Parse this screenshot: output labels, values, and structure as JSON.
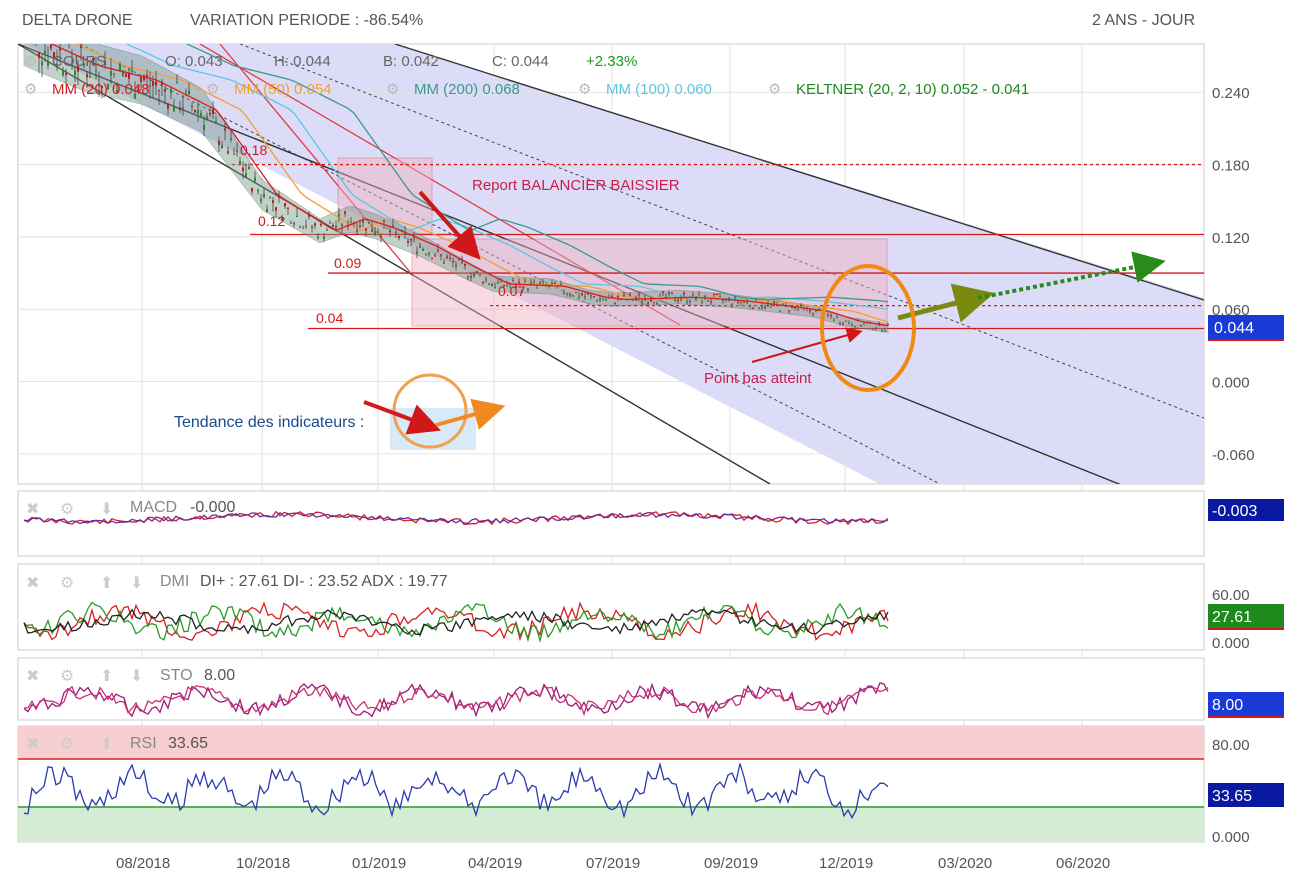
{
  "header": {
    "ticker": "DELTA DRONE",
    "variation": "VARIATION PERIODE : -86.54%",
    "period": "2 ANS - JOUR"
  },
  "legend": {
    "cours": "COURS",
    "o": "O: 0.043",
    "h": "H: 0.044",
    "b": "B: 0.042",
    "c": "C: 0.044",
    "change": "+2.33%",
    "mm20": "MM (20) 0.048",
    "mm50": "MM (50) 0.054",
    "mm200": "MM (200) 0.068",
    "mm100": "MM (100) 0.060",
    "keltner": "KELTNER (20, 2, 10) 0.052 - 0.041"
  },
  "annotations": {
    "report": "Report BALANCIER BAISSIER",
    "point_bas": "Point bas atteint",
    "tendance": "Tendance des indicateurs :",
    "lvl_018": "0.18",
    "lvl_012": "0.12",
    "lvl_009": "0.09",
    "lvl_007": "0.07",
    "lvl_004": "0.04"
  },
  "panels": {
    "macd": {
      "label": "MACD",
      "value": "-0.000",
      "badge": "-0.003"
    },
    "dmi": {
      "label": "DMI",
      "value": "DI+ : 27.61 DI- : 23.52 ADX : 19.77",
      "badge": "27.61",
      "ticks": [
        "60.00",
        "0.000"
      ]
    },
    "sto": {
      "label": "STO",
      "value": "8.00",
      "badge": "8.00"
    },
    "rsi": {
      "label": "RSI",
      "value": "33.65",
      "badge": "33.65",
      "ticks": [
        "80.00",
        "0.000"
      ]
    }
  },
  "colors": {
    "mm20": "#d81e1e",
    "mm50": "#f0a030",
    "mm200": "#3a9a8a",
    "mm100": "#5ac8e0",
    "keltner": "#1e8a1e",
    "change": "#1e9a1e",
    "channel": "#d8d8f8",
    "badge_price": "#1a3ad8",
    "badge_macd": "#0a1aa0",
    "badge_dmi": "#1e8a1e"
  },
  "chart_data": {
    "type": "line",
    "title": "DELTA DRONE",
    "x_ticks": [
      "08/2018",
      "10/2018",
      "01/2019",
      "04/2019",
      "07/2019",
      "09/2019",
      "12/2019",
      "03/2020",
      "06/2020"
    ],
    "y_ticks": [
      "0.240",
      "0.180",
      "0.120",
      "0.060",
      "0.000",
      "-0.060"
    ],
    "ylim": [
      -0.085,
      0.28
    ],
    "last_price_badge": "0.044",
    "horizontal_levels": [
      0.18,
      0.122,
      0.09,
      0.063,
      0.044
    ],
    "series": [
      {
        "name": "COURS",
        "points": [
          [
            "06/2018",
            0.285
          ],
          [
            "07/2018",
            0.262
          ],
          [
            "08/2018",
            0.25
          ],
          [
            "09/2018",
            0.225
          ],
          [
            "10/2018",
            0.155
          ],
          [
            "11/2018",
            0.125
          ],
          [
            "12/2018",
            0.135
          ],
          [
            "01/2019",
            0.128
          ],
          [
            "02/2019",
            0.113
          ],
          [
            "03/2019",
            0.095
          ],
          [
            "04/2019",
            0.081
          ],
          [
            "05/2019",
            0.079
          ],
          [
            "06/2019",
            0.07
          ],
          [
            "07/2019",
            0.068
          ],
          [
            "08/2019",
            0.07
          ],
          [
            "09/2019",
            0.067
          ],
          [
            "10/2019",
            0.062
          ],
          [
            "11/2019",
            0.058
          ],
          [
            "12/2019",
            0.05
          ],
          [
            "01/2020",
            0.044
          ]
        ]
      }
    ],
    "subcharts": [
      {
        "name": "MACD",
        "value": -0.0
      },
      {
        "name": "DMI",
        "di_plus": 27.61,
        "di_minus": 23.52,
        "adx": 19.77,
        "ylim": [
          0,
          60
        ]
      },
      {
        "name": "STO",
        "value": 8.0
      },
      {
        "name": "RSI",
        "value": 33.65,
        "ylim": [
          0,
          80
        ]
      }
    ]
  }
}
